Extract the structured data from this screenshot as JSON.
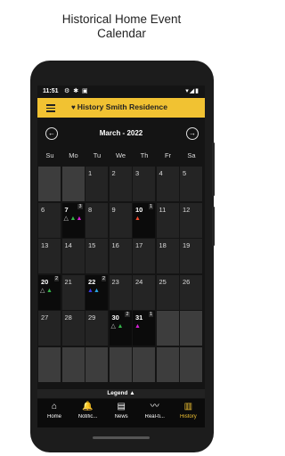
{
  "caption": {
    "line1": "Historical Home Event",
    "line2": "Calendar"
  },
  "status_bar": {
    "time": "11:51",
    "icons": "⚙ ✱ ▣",
    "right": "▾◢▮"
  },
  "app_bar": {
    "title": "History Smith Residence",
    "heart": "♥"
  },
  "calendar": {
    "month_label": "March - 2022",
    "prev": "←",
    "next": "→",
    "weekdays": [
      "Su",
      "Mo",
      "Tu",
      "We",
      "Th",
      "Fr",
      "Sa"
    ],
    "days": [
      {
        "n": "",
        "type": "empty"
      },
      {
        "n": "",
        "type": "empty"
      },
      {
        "n": "1"
      },
      {
        "n": "2"
      },
      {
        "n": "3"
      },
      {
        "n": "4"
      },
      {
        "n": "5"
      },
      {
        "n": "6"
      },
      {
        "n": "7",
        "type": "active",
        "count": "3",
        "markers": [
          {
            "s": "△",
            "c": "#cfcfcf"
          },
          {
            "s": "▲",
            "c": "#35b54a"
          },
          {
            "s": "▲",
            "c": "#d51fd5"
          }
        ]
      },
      {
        "n": "8"
      },
      {
        "n": "9"
      },
      {
        "n": "10",
        "type": "active",
        "count": "1",
        "markers": [
          {
            "s": "▲",
            "c": "#f0492b"
          }
        ]
      },
      {
        "n": "11"
      },
      {
        "n": "12"
      },
      {
        "n": "13"
      },
      {
        "n": "14"
      },
      {
        "n": "15"
      },
      {
        "n": "16"
      },
      {
        "n": "17"
      },
      {
        "n": "18"
      },
      {
        "n": "19"
      },
      {
        "n": "20",
        "type": "active",
        "count": "2",
        "markers": [
          {
            "s": "△",
            "c": "#cfcfcf"
          },
          {
            "s": "▲",
            "c": "#35b54a"
          }
        ]
      },
      {
        "n": "21"
      },
      {
        "n": "22",
        "type": "active",
        "count": "2",
        "markers": [
          {
            "s": "▲",
            "c": "#3a3ae8"
          },
          {
            "s": "▲",
            "c": "#2aa4e0"
          }
        ]
      },
      {
        "n": "23"
      },
      {
        "n": "24"
      },
      {
        "n": "25"
      },
      {
        "n": "26"
      },
      {
        "n": "27"
      },
      {
        "n": "28"
      },
      {
        "n": "29"
      },
      {
        "n": "30",
        "type": "active",
        "count": "2",
        "markers": [
          {
            "s": "△",
            "c": "#cfcfcf"
          },
          {
            "s": "▲",
            "c": "#35b54a"
          }
        ]
      },
      {
        "n": "31",
        "type": "active",
        "count": "1",
        "markers": [
          {
            "s": "▲",
            "c": "#d51fd5"
          }
        ]
      },
      {
        "n": "",
        "type": "empty"
      },
      {
        "n": "",
        "type": "empty"
      },
      {
        "n": "",
        "type": "empty"
      },
      {
        "n": "",
        "type": "empty"
      },
      {
        "n": "",
        "type": "empty"
      },
      {
        "n": "",
        "type": "empty"
      },
      {
        "n": "",
        "type": "empty"
      },
      {
        "n": "",
        "type": "empty"
      },
      {
        "n": "",
        "type": "empty"
      }
    ]
  },
  "legend": {
    "label": "Legend",
    "arrow": "▲"
  },
  "bottom_nav": [
    {
      "icon": "⌂",
      "label": "Home",
      "name": "home"
    },
    {
      "icon": "🔔",
      "label": "Notific...",
      "name": "notifications"
    },
    {
      "icon": "▤",
      "label": "News",
      "name": "news"
    },
    {
      "icon": "〰",
      "label": "Real-ti...",
      "name": "realtime"
    },
    {
      "icon": "▥",
      "label": "History",
      "name": "history",
      "active": true
    }
  ]
}
